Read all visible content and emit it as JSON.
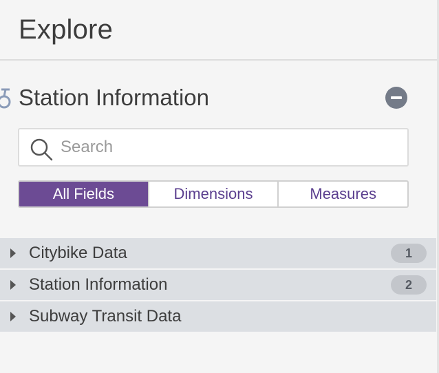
{
  "header": {
    "title": "Explore"
  },
  "model": {
    "icon": "bike-icon",
    "title": "Station Information",
    "collapse_icon": "minus-circle-icon"
  },
  "search": {
    "icon": "search-icon",
    "placeholder": "Search",
    "value": ""
  },
  "field_tabs": [
    {
      "label": "All Fields",
      "active": true
    },
    {
      "label": "Dimensions",
      "active": false
    },
    {
      "label": "Measures",
      "active": false
    }
  ],
  "views": [
    {
      "label": "Citybike Data",
      "count": "1"
    },
    {
      "label": "Station Information",
      "count": "2"
    },
    {
      "label": "Subway Transit Data",
      "count": ""
    }
  ],
  "colors": {
    "accent": "#6c4b94",
    "row_bg": "#dcdfe3",
    "badge_bg": "#c3c6cb",
    "collapse_button": "#747b88"
  }
}
